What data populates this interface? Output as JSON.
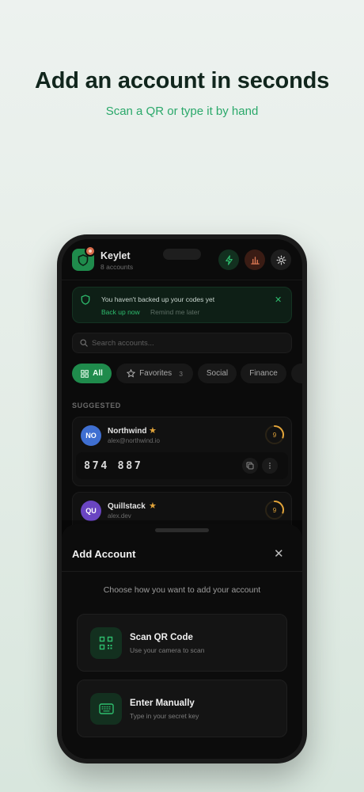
{
  "hero": {
    "title": "Add an account in seconds",
    "subtitle": "Scan a QR or type it by hand"
  },
  "app": {
    "name": "Keylet",
    "account_count": "8 accounts",
    "brand_color": "#1f8b4c",
    "header_actions": [
      "flash-icon",
      "stats-icon",
      "gear-icon"
    ]
  },
  "banner": {
    "message": "You haven't backed up your codes yet",
    "primary_action": "Back up now",
    "secondary_action": "Remind me later"
  },
  "search": {
    "placeholder": "Search accounts..."
  },
  "filters": [
    {
      "label": "All",
      "active": true
    },
    {
      "label": "Favorites",
      "count": "3",
      "active": false
    },
    {
      "label": "Social",
      "active": false
    },
    {
      "label": "Finance",
      "active": false
    }
  ],
  "section": {
    "label": "SUGGESTED"
  },
  "accounts": [
    {
      "initials": "NO",
      "name": "Northwind",
      "email": "alex@northwind.io",
      "code": "874 887",
      "timer": "9",
      "favorite": true,
      "color": "#3f6fd1"
    },
    {
      "initials": "QU",
      "name": "Quillstack",
      "email": "alex.dev",
      "timer": "9",
      "favorite": true,
      "color": "#6a45c2"
    }
  ],
  "sheet": {
    "title": "Add Account",
    "hint": "Choose how you want to add your account",
    "options": [
      {
        "title": "Scan QR Code",
        "description": "Use your camera to scan",
        "icon": "qr-code-icon"
      },
      {
        "title": "Enter Manually",
        "description": "Type in your secret key",
        "icon": "keyboard-icon"
      }
    ]
  }
}
